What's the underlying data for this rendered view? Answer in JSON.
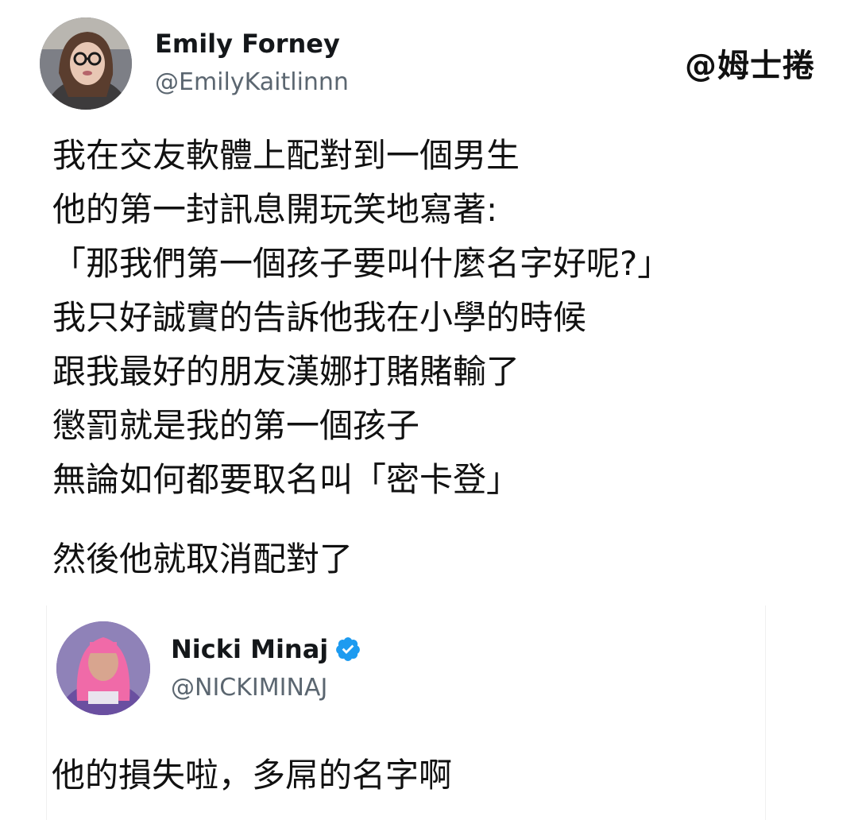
{
  "watermark": "@姆士捲",
  "tweet": {
    "author_name": "Emily Forney",
    "author_handle": "@EmilyKaitlinnn",
    "body_lines": [
      "我在交友軟體上配對到一個男生",
      "他的第一封訊息開玩笑地寫著:",
      "「那我們第一個孩子要叫什麼名字好呢?」",
      "我只好誠實的告訴他我在小學的時候",
      "跟我最好的朋友漢娜打賭賭輸了",
      "懲罰就是我的第一個孩子",
      "無論如何都要取名叫「密卡登」"
    ],
    "after_line": "然後他就取消配對了"
  },
  "reply": {
    "author_name": "Nicki Minaj",
    "author_handle": "@NICKIMINAJ",
    "verified_icon": "verified-badge-icon",
    "verified_color": "#1d9bf0",
    "body": "他的損失啦，多屌的名字啊"
  }
}
